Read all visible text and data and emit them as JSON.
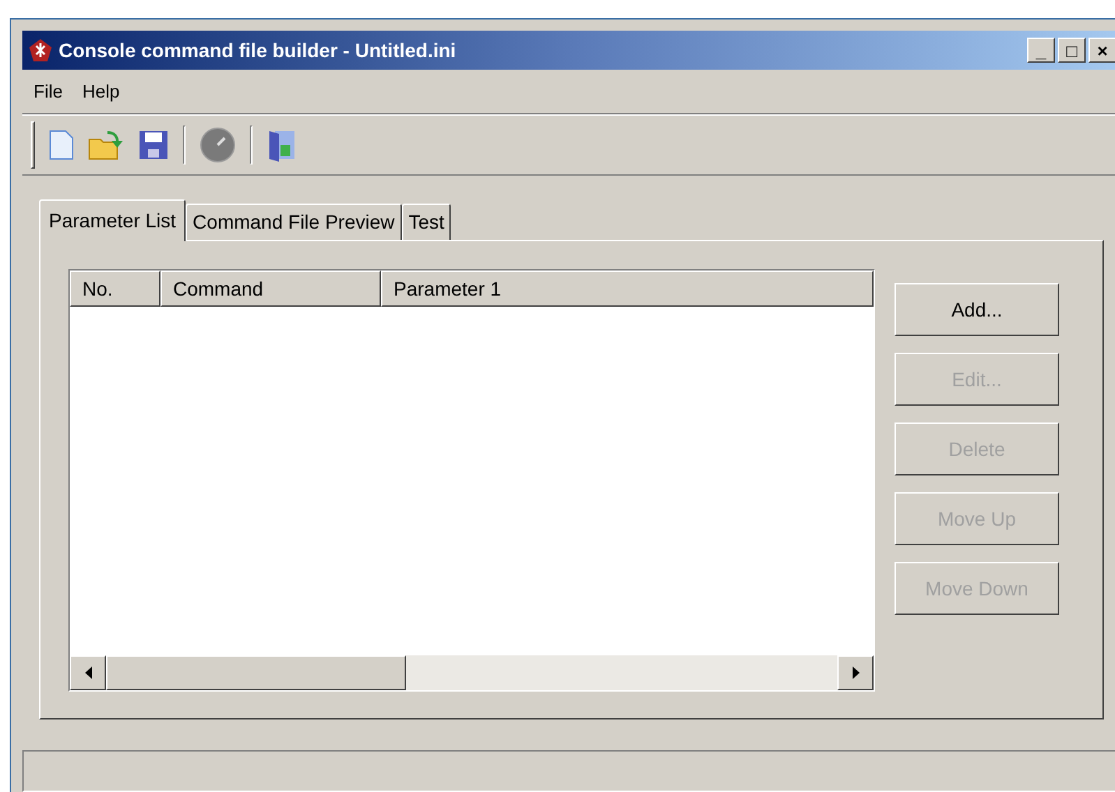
{
  "window": {
    "title": "Console command file builder - Untitled.ini",
    "controls": [
      "_",
      "□",
      "×"
    ]
  },
  "menu": [
    {
      "label": "File"
    },
    {
      "label": "Help"
    }
  ],
  "tabs": [
    {
      "label": "Parameter List",
      "selected": true
    },
    {
      "label": "Command File Preview",
      "selected": false
    },
    {
      "label": "Test",
      "selected": false
    }
  ],
  "table": {
    "columns": [
      "No.",
      "Command",
      "Parameter 1"
    ]
  },
  "buttons": [
    {
      "label": "Add...",
      "disabled": false
    },
    {
      "label": "Edit...",
      "disabled": true
    },
    {
      "label": "Delete",
      "disabled": true
    },
    {
      "label": "Move Up",
      "disabled": true
    },
    {
      "label": "Move Down",
      "disabled": true
    }
  ]
}
